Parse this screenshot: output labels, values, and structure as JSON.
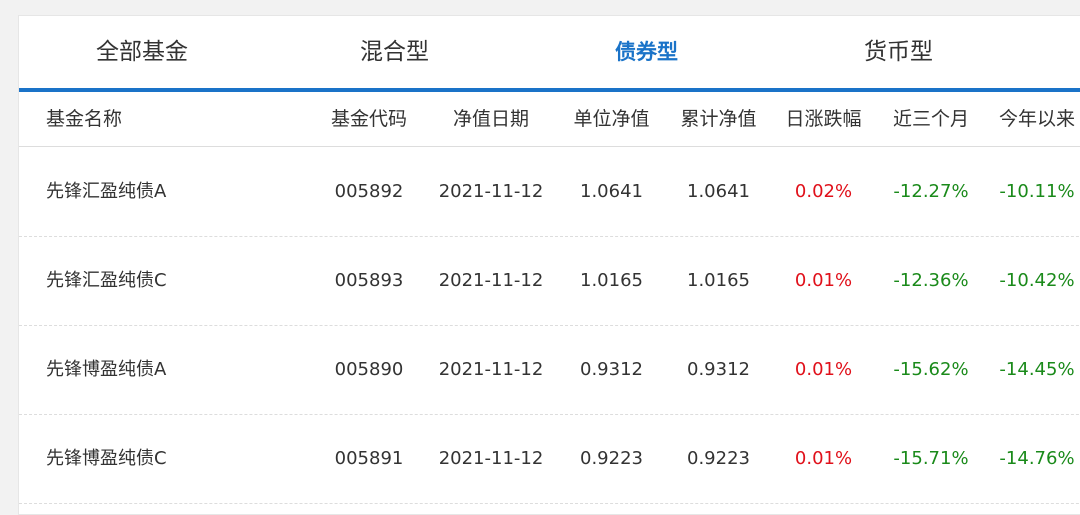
{
  "tabs": [
    {
      "label": "全部基金",
      "active": false
    },
    {
      "label": "混合型",
      "active": false
    },
    {
      "label": "债券型",
      "active": true
    },
    {
      "label": "货币型",
      "active": false
    }
  ],
  "table": {
    "headers": [
      "基金名称",
      "基金代码",
      "净值日期",
      "单位净值",
      "累计净值",
      "日涨跌幅",
      "近三个月",
      "今年以来"
    ],
    "rows": [
      {
        "name": "先锋汇盈纯债A",
        "code": "005892",
        "date": "2021-11-12",
        "unit_nav": "1.0641",
        "acc_nav": "1.0641",
        "daily_change": "0.02%",
        "three_month": "-12.27%",
        "ytd": "-10.11%"
      },
      {
        "name": "先锋汇盈纯债C",
        "code": "005893",
        "date": "2021-11-12",
        "unit_nav": "1.0165",
        "acc_nav": "1.0165",
        "daily_change": "0.01%",
        "three_month": "-12.36%",
        "ytd": "-10.42%"
      },
      {
        "name": "先锋博盈纯债A",
        "code": "005890",
        "date": "2021-11-12",
        "unit_nav": "0.9312",
        "acc_nav": "0.9312",
        "daily_change": "0.01%",
        "three_month": "-15.62%",
        "ytd": "-14.45%"
      },
      {
        "name": "先锋博盈纯债C",
        "code": "005891",
        "date": "2021-11-12",
        "unit_nav": "0.9223",
        "acc_nav": "0.9223",
        "daily_change": "0.01%",
        "three_month": "-15.71%",
        "ytd": "-14.76%"
      }
    ]
  },
  "colors": {
    "accent": "#1a73c8",
    "positive": "#e0101a",
    "negative": "#1a8a1a"
  }
}
